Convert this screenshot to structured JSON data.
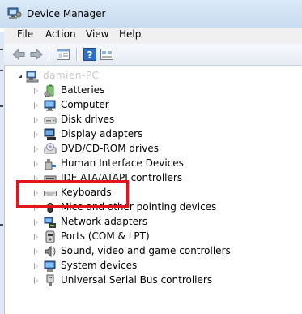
{
  "window": {
    "title": "Device Manager"
  },
  "menu": [
    "File",
    "Action",
    "View",
    "Help"
  ],
  "toolbar": {
    "buttons": [
      "back-arrow-icon",
      "forward-arrow-icon",
      "properties-icon",
      "help-icon",
      "show-hidden-icon"
    ]
  },
  "tree": {
    "root": "damien-PC",
    "items": [
      {
        "label": "Batteries",
        "icon": "battery-icon"
      },
      {
        "label": "Computer",
        "icon": "computer-icon"
      },
      {
        "label": "Disk drives",
        "icon": "disk-drive-icon"
      },
      {
        "label": "Display adapters",
        "icon": "display-adapter-icon"
      },
      {
        "label": "DVD/CD-ROM drives",
        "icon": "dvd-drive-icon"
      },
      {
        "label": "Human Interface Devices",
        "icon": "hid-icon"
      },
      {
        "label": "IDE ATA/ATAPI controllers",
        "icon": "ide-controller-icon"
      },
      {
        "label": "Keyboards",
        "icon": "keyboard-icon"
      },
      {
        "label": "Mice and other pointing devices",
        "icon": "mouse-icon"
      },
      {
        "label": "Network adapters",
        "icon": "network-adapter-icon"
      },
      {
        "label": "Ports (COM & LPT)",
        "icon": "port-icon"
      },
      {
        "label": "Sound, video and game controllers",
        "icon": "sound-icon"
      },
      {
        "label": "System devices",
        "icon": "system-device-icon"
      },
      {
        "label": "Universal Serial Bus controllers",
        "icon": "usb-icon"
      }
    ]
  },
  "colors": {
    "annotation": "#e3151c",
    "titlebar": "#dbe9f7"
  }
}
